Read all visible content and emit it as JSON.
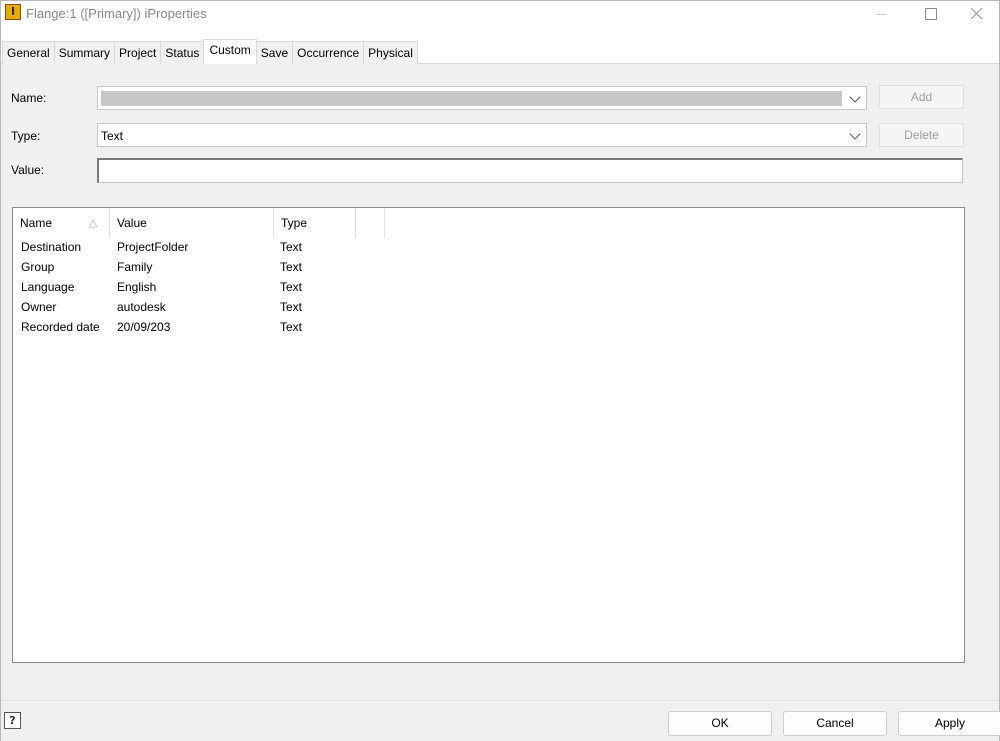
{
  "window": {
    "title": "Flange:1 ([Primary]) iProperties",
    "app_icon_letter": "I"
  },
  "tabs": [
    {
      "label": "General"
    },
    {
      "label": "Summary"
    },
    {
      "label": "Project"
    },
    {
      "label": "Status"
    },
    {
      "label": "Custom",
      "active": true
    },
    {
      "label": "Save"
    },
    {
      "label": "Occurrence"
    },
    {
      "label": "Physical"
    }
  ],
  "form": {
    "name_label": "Name:",
    "name_value": "",
    "type_label": "Type:",
    "type_value": "Text",
    "value_label": "Value:",
    "value_value": "",
    "add_button": "Add",
    "delete_button": "Delete"
  },
  "table": {
    "columns": [
      "Name",
      "Value",
      "Type"
    ],
    "sort_indicator": "sort-ascending-icon",
    "rows": [
      {
        "name": "Destination",
        "value": "ProjectFolder",
        "type": "Text"
      },
      {
        "name": "Group",
        "value": "Family",
        "type": "Text"
      },
      {
        "name": "Language",
        "value": "English",
        "type": "Text"
      },
      {
        "name": "Owner",
        "value": "autodesk",
        "type": "Text"
      },
      {
        "name": "Recorded date",
        "value": "20/09/203",
        "type": "Text"
      }
    ]
  },
  "footer": {
    "help_icon": "help-icon",
    "ok": "OK",
    "cancel": "Cancel",
    "apply": "Apply"
  },
  "colors": {
    "tab_active_bg": "#ffffff",
    "panel_bg": "#f0f0f0",
    "disabled_text": "#a0a0a0"
  }
}
